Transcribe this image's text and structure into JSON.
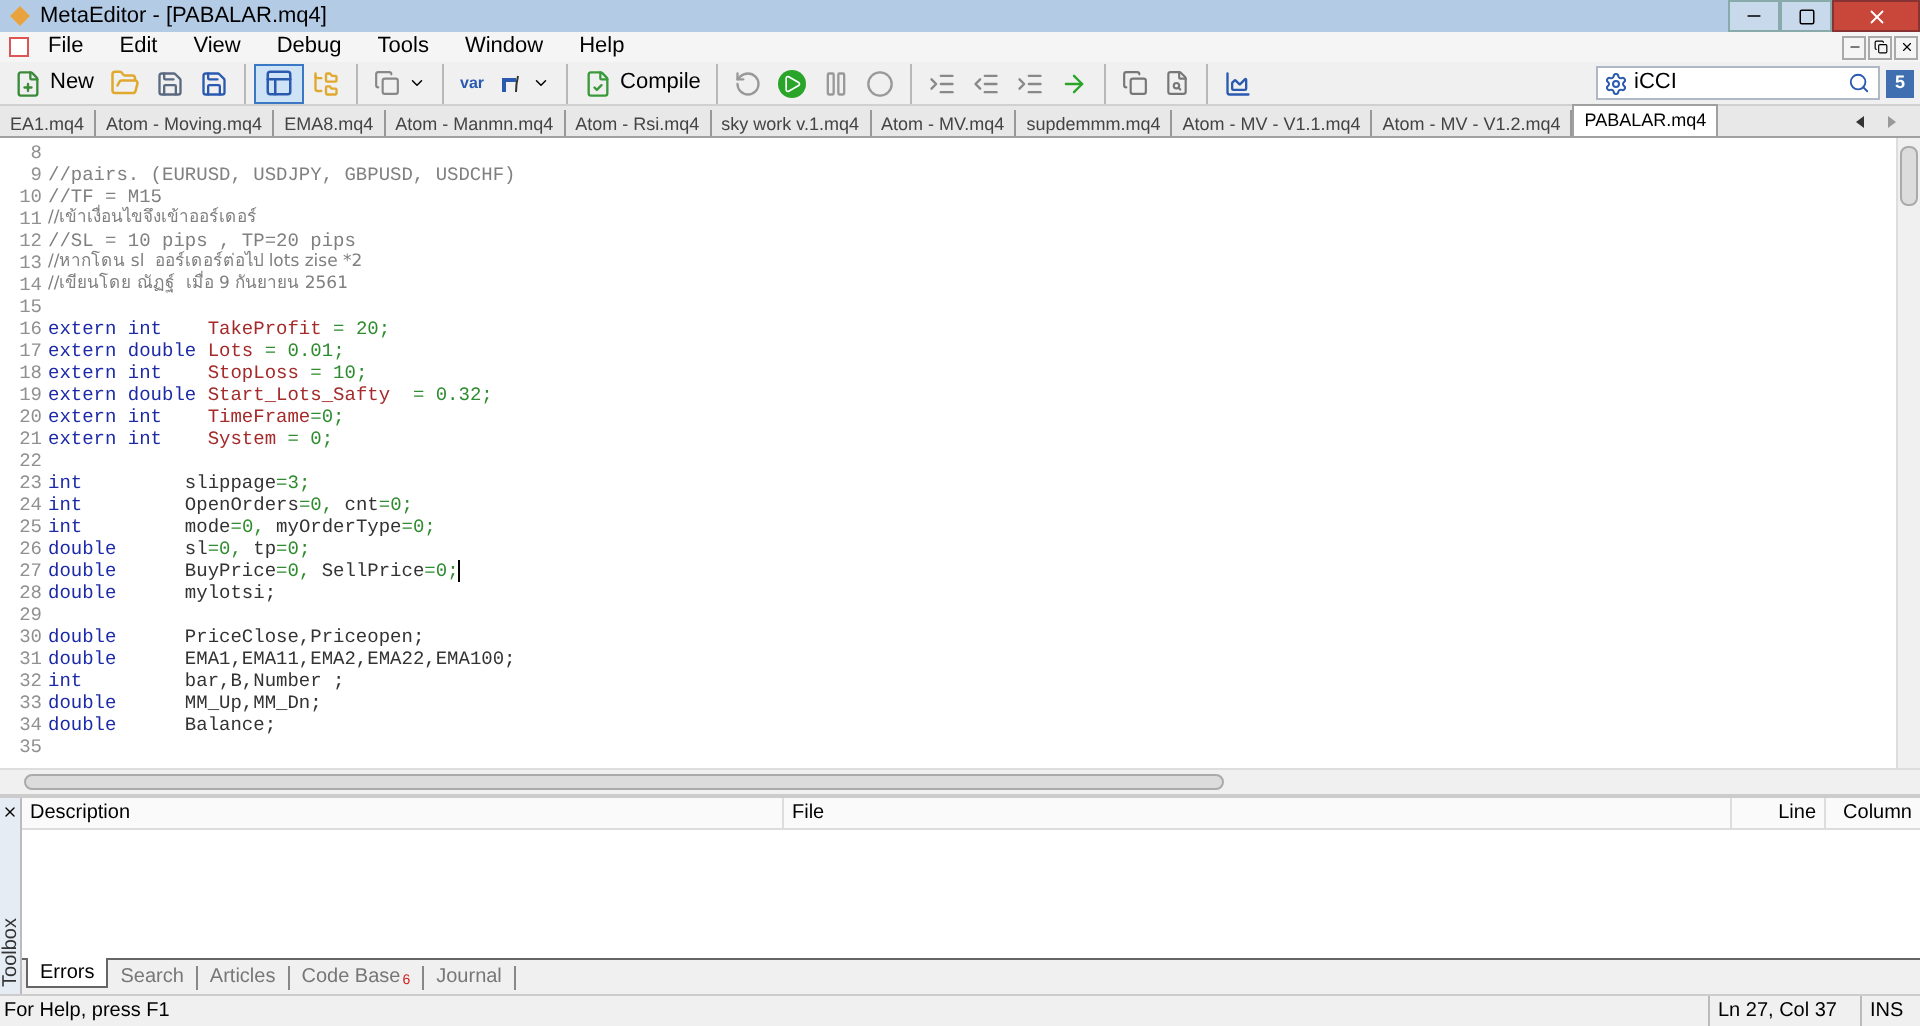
{
  "window": {
    "title": "MetaEditor - [PABALAR.mq4]"
  },
  "menu": [
    "File",
    "Edit",
    "View",
    "Debug",
    "Tools",
    "Window",
    "Help"
  ],
  "toolbar": {
    "new_label": "New",
    "var_label": "var",
    "compile_label": "Compile",
    "layout_selected": true,
    "search_value": "iCCI",
    "community_label": "5"
  },
  "tabs": [
    {
      "label": "EA1.mq4",
      "selected": false
    },
    {
      "label": "Atom - Moving.mq4",
      "selected": false
    },
    {
      "label": "EMA8.mq4",
      "selected": false
    },
    {
      "label": "Atom - Manmn.mq4",
      "selected": false
    },
    {
      "label": "Atom - Rsi.mq4",
      "selected": false
    },
    {
      "label": "sky work v.1.mq4",
      "selected": false
    },
    {
      "label": "Atom - MV.mq4",
      "selected": false
    },
    {
      "label": "supdemmm.mq4",
      "selected": false
    },
    {
      "label": "Atom - MV - V1.1.mq4",
      "selected": false
    },
    {
      "label": "Atom - MV - V1.2.mq4",
      "selected": false
    },
    {
      "label": "PABALAR.mq4",
      "selected": true
    }
  ],
  "editor": {
    "lines": [
      {
        "number": "8"
      },
      {
        "number": "9",
        "tokens": [
          {
            "kind": "comment",
            "text": "//pairs. (EURUSD, USDJPY, GBPUSD, USDCHF)"
          }
        ]
      },
      {
        "number": "10",
        "tokens": [
          {
            "kind": "comment",
            "text": "//TF = M15"
          }
        ]
      },
      {
        "number": "11",
        "tokens": [
          {
            "kind": "comment",
            "text": "//เข้าเงื่อนไขจึงเข้าออร์เดอร์"
          }
        ]
      },
      {
        "number": "12",
        "tokens": [
          {
            "kind": "comment",
            "text": "//SL = 10 pips , TP=20 pips"
          }
        ]
      },
      {
        "number": "13",
        "tokens": [
          {
            "kind": "comment",
            "text": "//หากโดน sl  ออร์เดอร์ต่อไป lots zise *2"
          }
        ]
      },
      {
        "number": "14",
        "tokens": [
          {
            "kind": "comment",
            "text": "//เขียนโดย ณัฏฐ์  เมื่อ 9 กันยายน 2561"
          }
        ]
      },
      {
        "number": "15"
      },
      {
        "number": "16",
        "tokens": [
          {
            "kind": "keyword",
            "text": "extern int    "
          },
          {
            "kind": "ident",
            "text": "TakeProfit"
          },
          {
            "kind": "op",
            "text": " = "
          },
          {
            "kind": "number",
            "text": "20"
          },
          {
            "kind": "op",
            "text": ";"
          }
        ]
      },
      {
        "number": "17",
        "tokens": [
          {
            "kind": "keyword",
            "text": "extern double "
          },
          {
            "kind": "ident",
            "text": "Lots"
          },
          {
            "kind": "op",
            "text": " = "
          },
          {
            "kind": "number",
            "text": "0.01"
          },
          {
            "kind": "op",
            "text": ";"
          }
        ]
      },
      {
        "number": "18",
        "tokens": [
          {
            "kind": "keyword",
            "text": "extern int    "
          },
          {
            "kind": "ident",
            "text": "StopLoss"
          },
          {
            "kind": "op",
            "text": " = "
          },
          {
            "kind": "number",
            "text": "10"
          },
          {
            "kind": "op",
            "text": ";"
          }
        ]
      },
      {
        "number": "19",
        "tokens": [
          {
            "kind": "keyword",
            "text": "extern double "
          },
          {
            "kind": "ident",
            "text": "Start_Lots_Safty"
          },
          {
            "kind": "op",
            "text": "  = "
          },
          {
            "kind": "number",
            "text": "0.32"
          },
          {
            "kind": "op",
            "text": ";"
          }
        ]
      },
      {
        "number": "20",
        "tokens": [
          {
            "kind": "keyword",
            "text": "extern int    "
          },
          {
            "kind": "ident",
            "text": "TimeFrame"
          },
          {
            "kind": "op",
            "text": "="
          },
          {
            "kind": "number",
            "text": "0"
          },
          {
            "kind": "op",
            "text": ";"
          }
        ]
      },
      {
        "number": "21",
        "tokens": [
          {
            "kind": "keyword",
            "text": "extern int    "
          },
          {
            "kind": "ident",
            "text": "System"
          },
          {
            "kind": "op",
            "text": " = "
          },
          {
            "kind": "number",
            "text": "0"
          },
          {
            "kind": "op",
            "text": ";"
          }
        ]
      },
      {
        "number": "22"
      },
      {
        "number": "23",
        "tokens": [
          {
            "kind": "keyword",
            "text": "int         "
          },
          {
            "kind": "plain",
            "text": "slippage"
          },
          {
            "kind": "op",
            "text": "="
          },
          {
            "kind": "number",
            "text": "3"
          },
          {
            "kind": "op",
            "text": ";"
          }
        ]
      },
      {
        "number": "24",
        "tokens": [
          {
            "kind": "keyword",
            "text": "int         "
          },
          {
            "kind": "plain",
            "text": "OpenOrders"
          },
          {
            "kind": "op",
            "text": "="
          },
          {
            "kind": "number",
            "text": "0"
          },
          {
            "kind": "op",
            "text": ","
          },
          {
            "kind": "plain",
            "text": " cnt"
          },
          {
            "kind": "op",
            "text": "="
          },
          {
            "kind": "number",
            "text": "0"
          },
          {
            "kind": "op",
            "text": ";"
          }
        ]
      },
      {
        "number": "25",
        "tokens": [
          {
            "kind": "keyword",
            "text": "int         "
          },
          {
            "kind": "plain",
            "text": "mode"
          },
          {
            "kind": "op",
            "text": "="
          },
          {
            "kind": "number",
            "text": "0"
          },
          {
            "kind": "op",
            "text": ","
          },
          {
            "kind": "plain",
            "text": " myOrderType"
          },
          {
            "kind": "op",
            "text": "="
          },
          {
            "kind": "number",
            "text": "0"
          },
          {
            "kind": "op",
            "text": ";"
          }
        ]
      },
      {
        "number": "26",
        "tokens": [
          {
            "kind": "keyword",
            "text": "double      "
          },
          {
            "kind": "plain",
            "text": "sl"
          },
          {
            "kind": "op",
            "text": "="
          },
          {
            "kind": "number",
            "text": "0"
          },
          {
            "kind": "op",
            "text": ","
          },
          {
            "kind": "plain",
            "text": " tp"
          },
          {
            "kind": "op",
            "text": "="
          },
          {
            "kind": "number",
            "text": "0"
          },
          {
            "kind": "op",
            "text": ";"
          }
        ]
      },
      {
        "number": "27",
        "tokens": [
          {
            "kind": "keyword",
            "text": "double      "
          },
          {
            "kind": "plain",
            "text": "BuyPrice"
          },
          {
            "kind": "op",
            "text": "="
          },
          {
            "kind": "number",
            "text": "0"
          },
          {
            "kind": "op",
            "text": ","
          },
          {
            "kind": "plain",
            "text": " SellPrice"
          },
          {
            "kind": "op",
            "text": "="
          },
          {
            "kind": "number",
            "text": "0"
          },
          {
            "kind": "op",
            "text": ";"
          }
        ],
        "cursor": true
      },
      {
        "number": "28",
        "tokens": [
          {
            "kind": "keyword",
            "text": "double      "
          },
          {
            "kind": "plain",
            "text": "mylotsi;"
          }
        ]
      },
      {
        "number": "29"
      },
      {
        "number": "30",
        "tokens": [
          {
            "kind": "keyword",
            "text": "double      "
          },
          {
            "kind": "plain",
            "text": "PriceClose,Priceopen;"
          }
        ]
      },
      {
        "number": "31",
        "tokens": [
          {
            "kind": "keyword",
            "text": "double      "
          },
          {
            "kind": "plain",
            "text": "EMA1,EMA11,EMA2,EMA22,EMA100;"
          }
        ]
      },
      {
        "number": "32",
        "tokens": [
          {
            "kind": "keyword",
            "text": "int         "
          },
          {
            "kind": "plain",
            "text": "bar,B,Number ;"
          }
        ]
      },
      {
        "number": "33",
        "tokens": [
          {
            "kind": "keyword",
            "text": "double      "
          },
          {
            "kind": "plain",
            "text": "MM_Up,MM_Dn;"
          }
        ]
      },
      {
        "number": "34",
        "tokens": [
          {
            "kind": "keyword",
            "text": "double      "
          },
          {
            "kind": "plain",
            "text": "Balance;"
          }
        ]
      },
      {
        "number": "35"
      }
    ]
  },
  "toolbox": {
    "label": "Toolbox",
    "columns": [
      "Description",
      "File",
      "Line",
      "Column"
    ],
    "tabs": [
      {
        "label": "Errors",
        "selected": true
      },
      {
        "label": "Search",
        "selected": false
      },
      {
        "label": "Articles",
        "selected": false
      },
      {
        "label": "Code Base",
        "selected": false,
        "badge": "6"
      },
      {
        "label": "Journal",
        "selected": false
      }
    ]
  },
  "status_bar": {
    "help": "For Help, press F1",
    "position": "Ln 27, Col 37",
    "mode": "INS"
  }
}
